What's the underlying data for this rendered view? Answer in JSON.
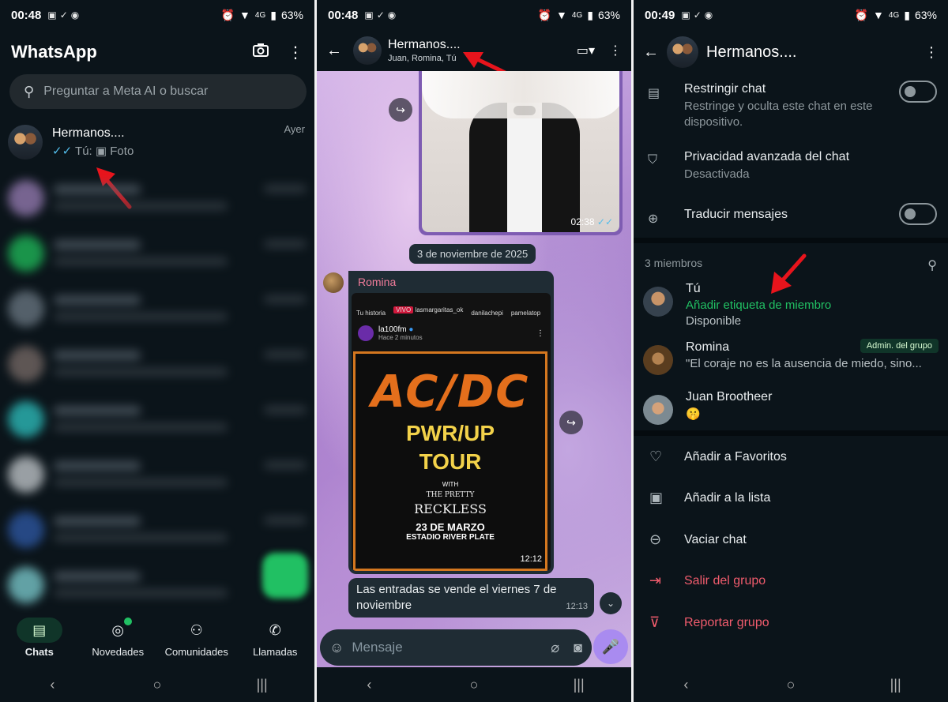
{
  "status": {
    "p1_time": "00:48",
    "p2_time": "00:48",
    "p3_time": "00:49",
    "network": "4G",
    "battery": "63%"
  },
  "panel1": {
    "app_title": "WhatsApp",
    "search_placeholder": "Preguntar a Meta AI o buscar",
    "chat": {
      "name": "Hermanos....",
      "time": "Ayer",
      "sender": "Tú:",
      "preview": "Foto"
    },
    "nav": [
      {
        "label": "Chats"
      },
      {
        "label": "Novedades"
      },
      {
        "label": "Comunidades"
      },
      {
        "label": "Llamadas"
      }
    ]
  },
  "panel2": {
    "group_name": "Hermanos....",
    "members_line": "Juan, Romina, Tú",
    "image_time": "02:38",
    "date_chip": "3 de noviembre de 2025",
    "sender": "Romina",
    "ig": {
      "stories": [
        "Tu historia",
        "lasmargaritas_ok",
        "danilachepi",
        "pamelatop"
      ],
      "live_label": "VIVO",
      "account": "la100fm",
      "posted": "Hace 2 minutos"
    },
    "poster": {
      "line1": "AC/DC",
      "line2": "PWR/UP",
      "line3": "TOUR",
      "with": "WITH",
      "band1": "THE PRETTY",
      "band2": "RECKLESS",
      "date": "23 DE MARZO",
      "venue": "ESTADIO RIVER PLATE"
    },
    "poster_time": "12:12",
    "message": "Las entradas se vende el viernes 7 de noviembre",
    "message_time": "12:13",
    "composer_placeholder": "Mensaje"
  },
  "panel3": {
    "group_name": "Hermanos....",
    "settings": [
      {
        "title": "Restringir chat",
        "subtitle": "Restringe y oculta este chat en este dispositivo."
      },
      {
        "title": "Privacidad avanzada del chat",
        "subtitle": "Desactivada"
      },
      {
        "title": "Traducir mensajes",
        "subtitle": ""
      }
    ],
    "member_count": "3 miembros",
    "members": [
      {
        "name": "Tú",
        "label": "Añadir etiqueta de miembro",
        "status": "Disponible"
      },
      {
        "name": "Romina",
        "status": "\"El coraje no es la ausencia de miedo, sino..."
      },
      {
        "name": "Juan Brootheer",
        "status": "🤫"
      }
    ],
    "admin_badge": "Admin. del grupo",
    "actions": [
      {
        "label": "Añadir a Favoritos"
      },
      {
        "label": "Añadir a la lista"
      },
      {
        "label": "Vaciar chat"
      },
      {
        "label": "Salir del grupo"
      },
      {
        "label": "Reportar grupo"
      }
    ]
  },
  "colors": {
    "accent_green": "#21c063",
    "danger_red": "#f15c6d",
    "annotation_arrow": "#e8141c"
  }
}
